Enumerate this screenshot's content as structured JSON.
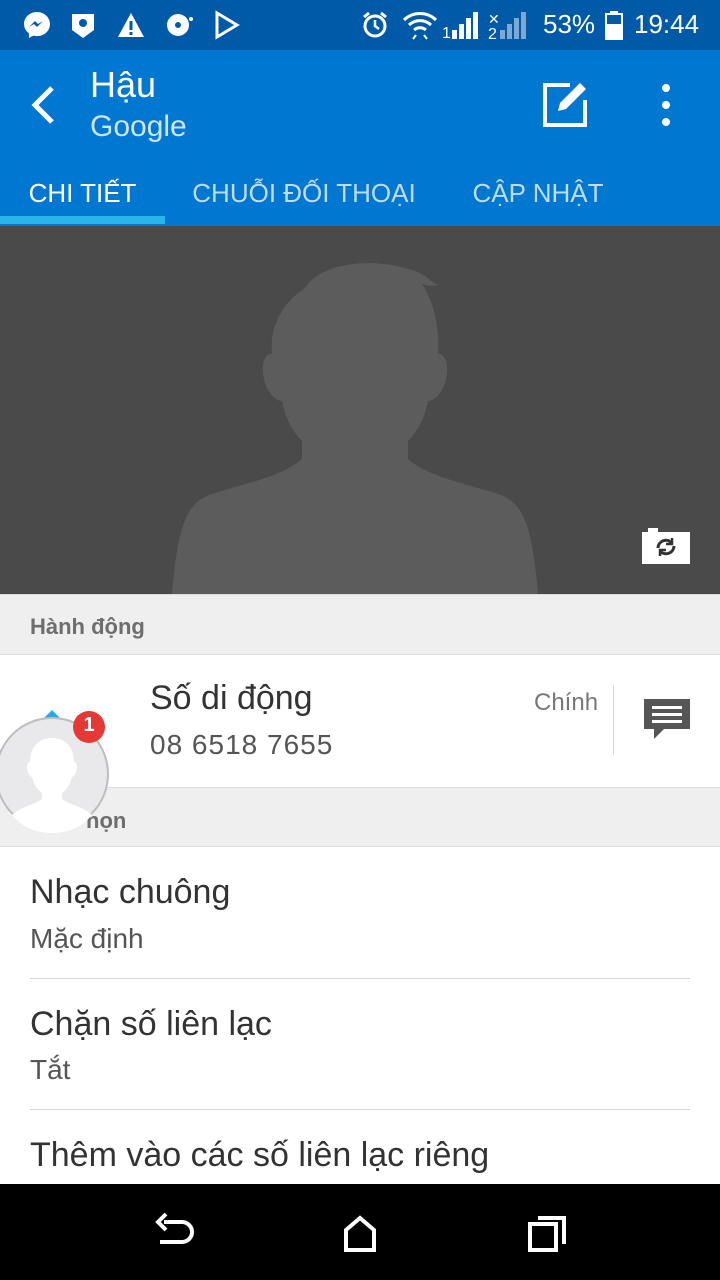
{
  "status_bar": {
    "left_icons": [
      "messenger-icon",
      "maps-icon",
      "warning-icon",
      "music-icon",
      "play-store-icon"
    ],
    "battery_percent": "53%",
    "time": "19:44"
  },
  "header": {
    "title": "Hậu",
    "subtitle": "Google",
    "tabs": [
      {
        "label": "CHI TIẾT"
      },
      {
        "label": "CHUỖI ĐỐI THOẠI"
      },
      {
        "label": "CẬP NHẬT"
      }
    ]
  },
  "actions_section": {
    "header": "Hành động",
    "phone": {
      "label": "Số di động",
      "number": "08 6518 7655",
      "tag": "Chính"
    }
  },
  "options_section": {
    "header_visible": "họn",
    "items": [
      {
        "title": "Nhạc chuông",
        "subtitle": "Mặc định"
      },
      {
        "title": "Chặn số liên lạc",
        "subtitle": "Tắt"
      },
      {
        "title": "Thêm vào các số liên lạc riêng"
      }
    ]
  },
  "chat_head": {
    "badge_count": "1"
  },
  "colors": {
    "status_bar": "#005aa8",
    "app_bar": "#0077d0",
    "tab_indicator": "#29b5ea",
    "photo_bg": "#4a4a4a",
    "badge": "#e53935"
  }
}
